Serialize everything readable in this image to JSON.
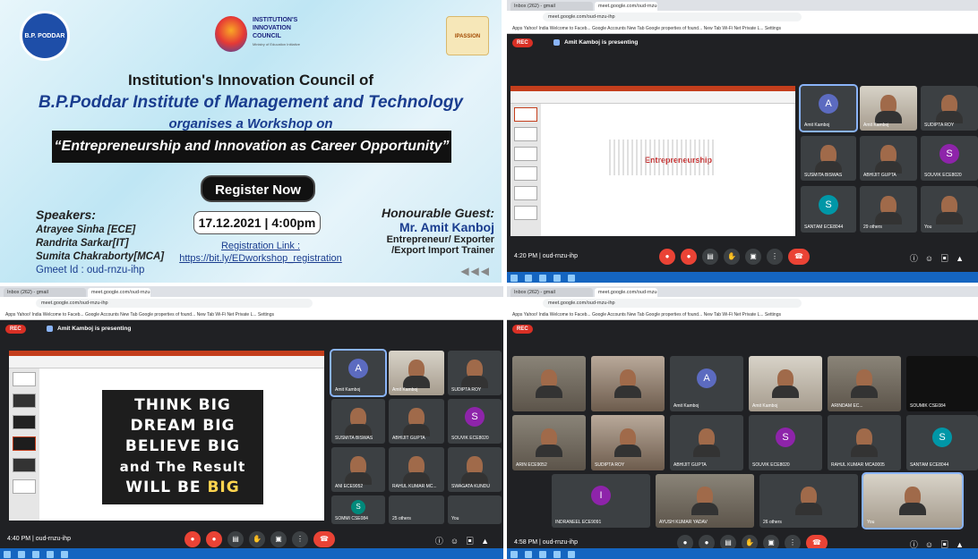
{
  "poster": {
    "logo_org": "B.P. PODDAR",
    "council_logo_line1": "INSTITUTION'S",
    "council_logo_line2": "INNOVATION",
    "council_logo_line3": "COUNCIL",
    "council_logo_sub": "Ministry of Education Initiative",
    "badge": "IPASSION",
    "title_line1": "Institution's Innovation Council of",
    "title_line2": "B.P.Poddar Institute of Management and Technology",
    "title_line3": "organises a Workshop on",
    "topic": "“Entrepreneurship and Innovation as Career Opportunity”",
    "register_button": "Register Now",
    "date_time": "17.12.2021 | 4:00pm",
    "speakers_heading": "Speakers:",
    "speakers": [
      "Atrayee Sinha [ECE]",
      "Randrita Sarkar[IT]",
      "Sumita Chakraborty[MCA]"
    ],
    "gmeet": "Gmeet Id : oud-rnzu-ihp",
    "registration_label": "Registration Link :",
    "registration_url": "https://bit.ly/EDworkshop_registration",
    "guest_heading": "Honourable Guest:",
    "guest_name": "Mr. Amit Kanboj",
    "guest_role1": "Entrepreneur/ Exporter",
    "guest_role2": "/Export Import Trainer"
  },
  "meet_common": {
    "rec": "REC",
    "presenting": "Amit Kamboj is presenting",
    "url": "meet.google.com/oud-rnzu-ihp",
    "bookmarks": "Apps   Yahoo! India   Welcome to Faceb...   Google Accounts   New Tab   Google   properties of found...   New Tab   Wi-Fi Net Private L...   Settings"
  },
  "screen2": {
    "time": "4:20 PM  |  oud-rnzu-ihp",
    "slide_word": "Entrepreneurship",
    "tiles": [
      "Amit Kamboj",
      "Amit Kamboj",
      "SUDIPTA ROY",
      "SUSMITA BISWAS",
      "ABHIJIT GUPTA",
      "SOUVIK ECE8020",
      "SANTAM ECE8044",
      "29 others",
      "You"
    ]
  },
  "screen3": {
    "time": "4:40 PM  |  oud-rnzu-ihp",
    "chalk": [
      "THINK BIG",
      "DREAM BIG",
      "BELIEVE BIG",
      "and The Result"
    ],
    "chalk_last_pre": "WILL BE ",
    "chalk_last_big": "BIG",
    "tiles": [
      "Amit Kamboj",
      "Amit Kamboj",
      "SUDIPTA ROY",
      "SUSMITA BISWAS",
      "ABHIJIT GUPTA",
      "SOUVIK ECE8020",
      "ANI ECE9052",
      "RAHUL KUMAR MC...",
      "SWAGATA KUNDU",
      "SOMMI CSE084",
      "25 others",
      "You"
    ]
  },
  "screen4": {
    "time": "4:58 PM  |  oud-rnzu-ihp",
    "tiles": [
      "",
      "",
      "Amit Kamboj",
      "Amit Kamboj",
      "ARINDAM EC...",
      "SOUMIK CSE084",
      "ARIN ECE9052",
      "SUDIPTA ROY",
      "ABHIJIT GUPTA",
      "SOUVIK ECE8020",
      "RAHUL KUMAR MCA0005",
      "SANTAM ECE8044",
      "INDRANEEL ECE9091",
      "AYUSH KUMAR YADAV",
      "26 others",
      "You"
    ]
  },
  "colors": {
    "rec": "#d93025",
    "meet_bg": "#202124",
    "tile": "#3c4043",
    "end_call": "#ea4335"
  }
}
